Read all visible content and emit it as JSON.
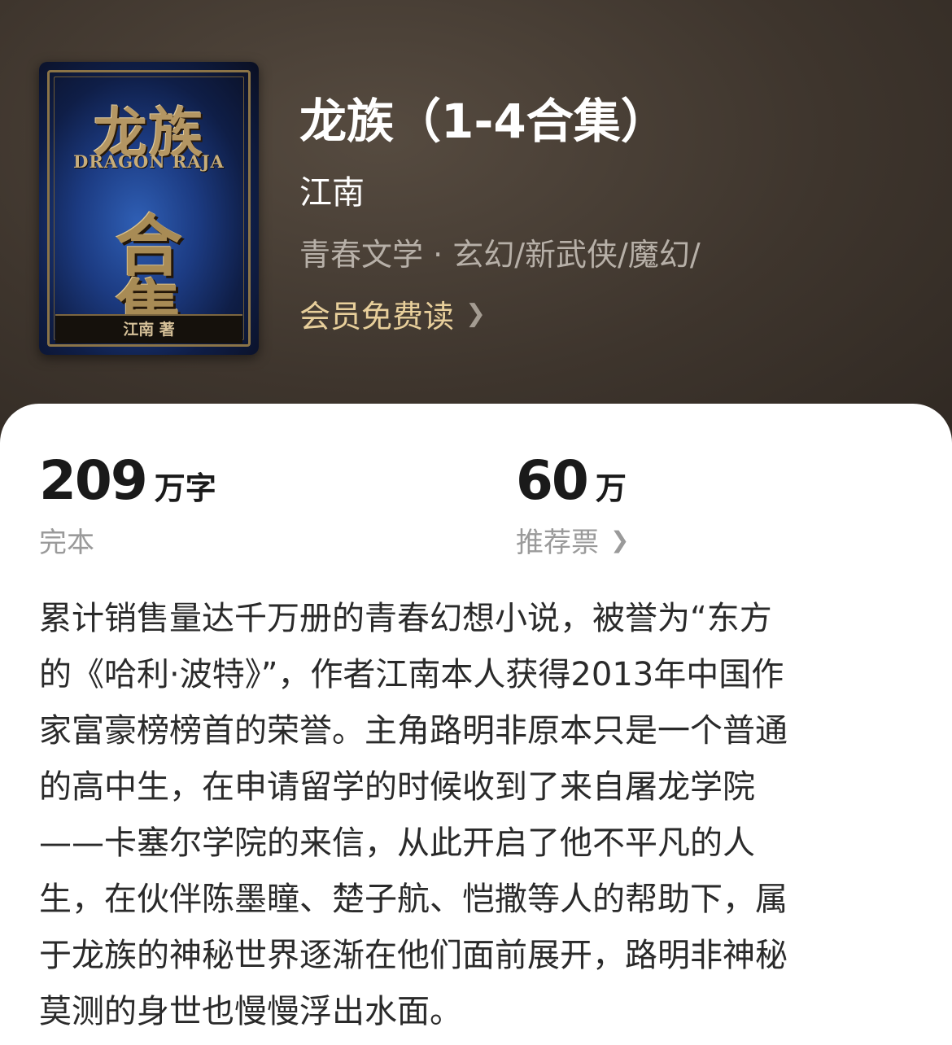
{
  "cover": {
    "title": "龙族",
    "subtitle": "DRAGON RAJA",
    "char1": "合",
    "char2": "集",
    "author": "江南 著"
  },
  "book": {
    "title": "龙族（1-4合集）",
    "author": "江南",
    "tags": "青春文学 · 玄幻/新武侠/魔幻/",
    "member_label": "会员免费读"
  },
  "stats": {
    "words": {
      "value": "209",
      "unit": "万字",
      "label": "完本"
    },
    "votes": {
      "value": "60",
      "unit": "万",
      "label": "推荐票"
    }
  },
  "description": {
    "lines": [
      "累计销售量达千万册的青春幻想小说，被誉为“东方",
      "的《哈利·波特》”，作者江南本人获得2013年中国作",
      "家富豪榜榜首的荣誉。主角路明非原本只是一个普通",
      "的高中生，在申请留学的时候收到了来自屠龙学院",
      "——卡塞尔学院的来信，从此开启了他不平凡的人",
      "生，在伙伴陈墨瞳、楚子航、恺撒等人的帮助下，属",
      "于龙族的神秘世界逐渐在他们面前展开，路明非神秘",
      "莫测的身世也慢慢浮出水面。"
    ]
  },
  "icons": {
    "chevron": "chevron-right-icon"
  },
  "colors": {
    "header_bg": "#3e362f",
    "member_gold": "#e8cf9b",
    "sheet_bg": "#ffffff"
  }
}
